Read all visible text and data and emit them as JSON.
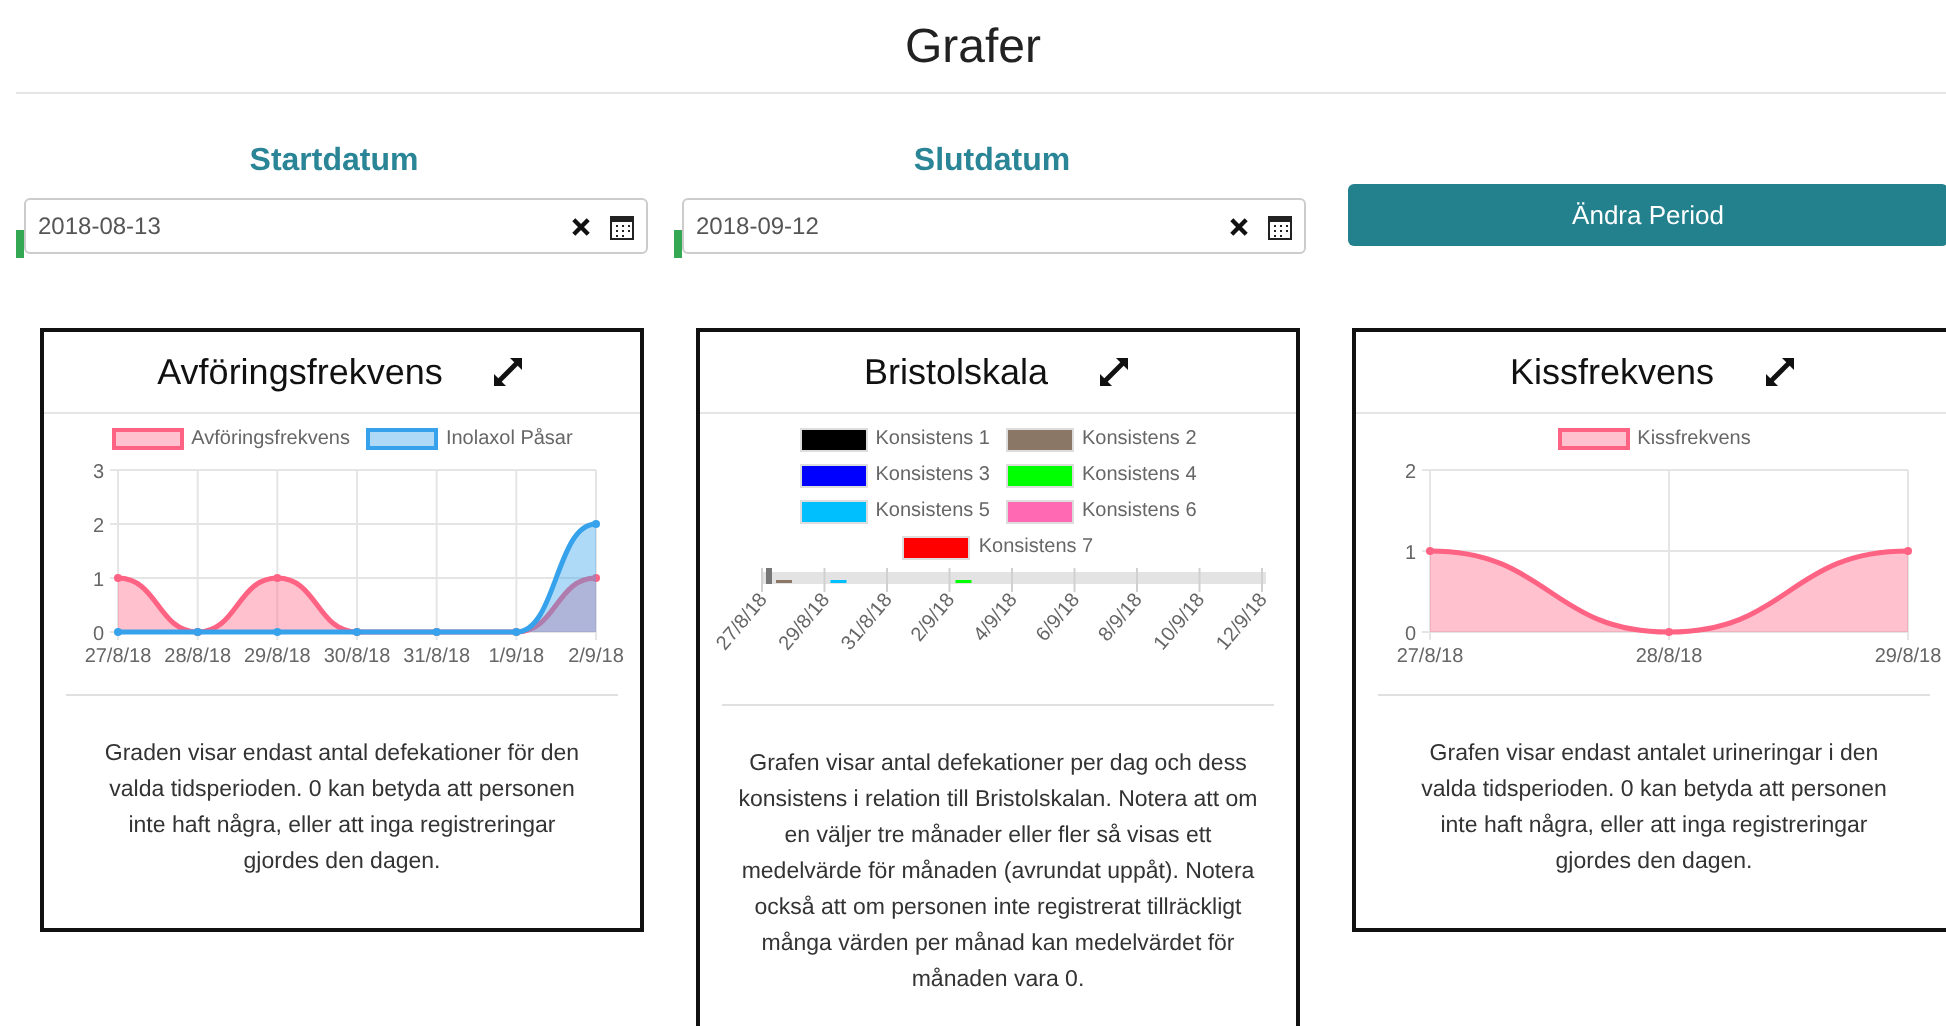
{
  "title": "Grafer",
  "period": {
    "fields": [
      {
        "label": "Startdatum",
        "value": "2018-08-13",
        "valid": true
      },
      {
        "label": "Slutdatum",
        "value": "2018-09-12",
        "valid": true
      }
    ],
    "button": "Ändra Period"
  },
  "cards": [
    {
      "kind": "line",
      "title": "Avföringsfrekvens",
      "description": "Graden visar endast antal defekationer för den valda tidsperioden. 0 kan betyda att personen inte haft några, eller att inga registreringar gjordes den dagen.",
      "chart_data": {
        "type": "area",
        "grid": true,
        "categories": [
          "27/8/18",
          "28/8/18",
          "29/8/18",
          "30/8/18",
          "31/8/18",
          "1/9/18",
          "2/9/18"
        ],
        "ylim": [
          0,
          3
        ],
        "yticks": [
          0,
          1,
          2,
          3
        ],
        "series": [
          {
            "name": "Avföringsfrekvens",
            "color": "#ff6384",
            "values": [
              1,
              0,
              1,
              0,
              0,
              0,
              1
            ]
          },
          {
            "name": "Inolaxol Påsar",
            "color": "#36a2eb",
            "values": [
              0,
              0,
              0,
              0,
              0,
              0,
              2
            ]
          }
        ]
      }
    },
    {
      "kind": "bristol",
      "title": "Bristolskala",
      "description": "Grafen visar antal defekationer per dag och dess konsistens i relation till Bristolskalan. Notera att om en väljer tre månader eller fler så visas ett medelvärde för månaden (avrundat uppåt). Notera också att om personen inte registrerat tillräckligt många värden per månad kan medelvärdet för månaden vara 0.",
      "x_labels": [
        "27/8/18",
        "29/8/18",
        "31/8/18",
        "2/9/18",
        "4/9/18",
        "6/9/18",
        "8/9/18",
        "10/9/18",
        "12/9/18"
      ],
      "legend": [
        {
          "name": "Konsistens 1",
          "color": "#000000"
        },
        {
          "name": "Konsistens 2",
          "color": "#8b7765"
        },
        {
          "name": "Konsistens 3",
          "color": "#0000ff"
        },
        {
          "name": "Konsistens 4",
          "color": "#00ff00"
        },
        {
          "name": "Konsistens 5",
          "color": "#00bfff"
        },
        {
          "name": "Konsistens 6",
          "color": "#ff69b4"
        },
        {
          "name": "Konsistens 7",
          "color": "#ff0000"
        }
      ]
    },
    {
      "kind": "line",
      "title": "Kissfrekvens",
      "description": "Grafen visar endast antalet urineringar i den valda tidsperioden. 0 kan betyda att personen inte haft några, eller att inga registreringar gjordes den dagen.",
      "chart_data": {
        "type": "area",
        "grid": true,
        "categories": [
          "27/8/18",
          "28/8/18",
          "29/8/18"
        ],
        "ylim": [
          0,
          2
        ],
        "yticks": [
          0,
          1,
          2
        ],
        "series": [
          {
            "name": "Kissfrekvens",
            "color": "#ff6384",
            "values": [
              1,
              0,
              1
            ]
          }
        ]
      }
    }
  ]
}
